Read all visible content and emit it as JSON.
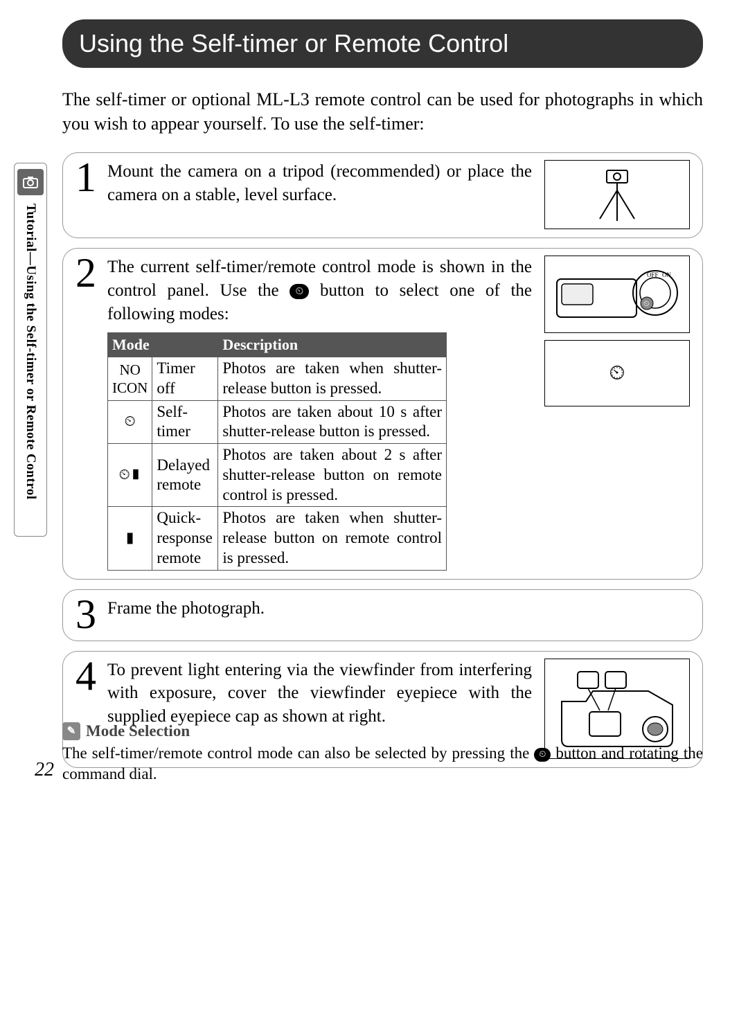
{
  "header_title": "Using the Self-timer or Remote Control",
  "intro": "The self-timer or optional ML-L3 remote control can be used for photographs in which you wish to appear yourself.  To use the self-timer:",
  "sidebar_label": "Tutorial—Using the Self-timer or Remote Control",
  "steps": {
    "s1": {
      "num": "1",
      "text": "Mount the camera on a tripod (recommended) or place the camera on a stable, level surface."
    },
    "s2": {
      "num": "2",
      "text_a": "The current self-timer/remote control mode is shown in the control panel.  Use the ",
      "text_b": " button to select one of the following modes:"
    },
    "s3": {
      "num": "3",
      "text": "Frame the photograph."
    },
    "s4": {
      "num": "4",
      "text": "To prevent light entering via the viewfinder from interfering with exposure, cover the viewfinder eyepiece with the supplied eyepiece cap as shown at right."
    }
  },
  "table": {
    "head_mode": "Mode",
    "head_desc": "Description",
    "rows": [
      {
        "icon": "NO ICON",
        "label": "Timer off",
        "desc": "Photos are taken when shutter-release button is pressed."
      },
      {
        "icon": "⏲",
        "label": "Self-timer",
        "desc": "Photos are taken about 10 s after shutter-release button is pressed."
      },
      {
        "icon": "⏲▮",
        "label": "Delayed remote",
        "desc": "Photos are taken about 2 s after shutter-release button on remote control is pressed."
      },
      {
        "icon": "▮",
        "label": "Quick-response remote",
        "desc": "Photos are taken when shutter-release button on remote control is pressed."
      }
    ]
  },
  "lcd_icon": "⏲",
  "note": {
    "title": "Mode Selection",
    "body_a": "The self-timer/remote control mode can also be selected by pressing the ",
    "body_b": " button and rotating the command dial."
  },
  "page_number": "22"
}
